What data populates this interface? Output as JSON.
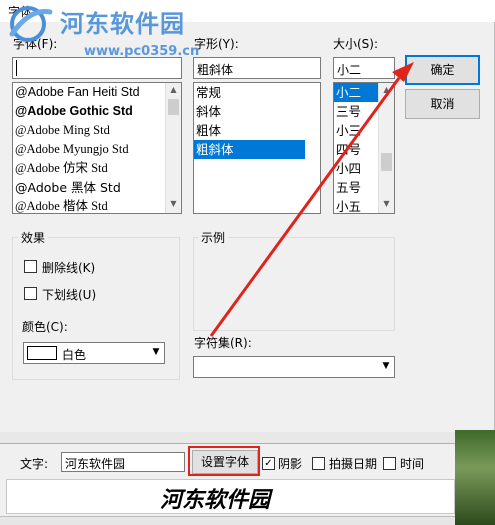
{
  "dialog": {
    "title": "字体",
    "font_label": "字体(F):",
    "font_value": "",
    "fonts": [
      "@Adobe Fan Heiti Std",
      "@Adobe Gothic Std",
      "@Adobe Ming Std",
      "@Adobe Myungjo Std",
      "@Adobe 仿宋 Std",
      "@Adobe 黑体 Std",
      "@Adobe 楷体 Std"
    ],
    "style_label": "字形(Y):",
    "style_value": "粗斜体",
    "styles": [
      "常规",
      "斜体",
      "粗体",
      "粗斜体"
    ],
    "size_label": "大小(S):",
    "size_value": "小二",
    "sizes": [
      "小二",
      "三号",
      "小三",
      "四号",
      "小四",
      "五号",
      "小五"
    ],
    "ok_label": "确定",
    "cancel_label": "取消",
    "effects_label": "效果",
    "strikeout_label": "删除线(K)",
    "underline_label": "下划线(U)",
    "color_label": "颜色(C):",
    "color_value": "白色",
    "sample_label": "示例",
    "charset_label": "字符集(R):",
    "charset_value": ""
  },
  "watermark": {
    "site_name": "河东软件园",
    "url": "www.pc0359.cn"
  },
  "app": {
    "text_label": "文字:",
    "text_value": "河东软件园",
    "set_font_label": "设置字体",
    "shadow_label": "阴影",
    "date_label": "拍摄日期",
    "time_label": "时间",
    "preview_text": "河东软件园"
  }
}
